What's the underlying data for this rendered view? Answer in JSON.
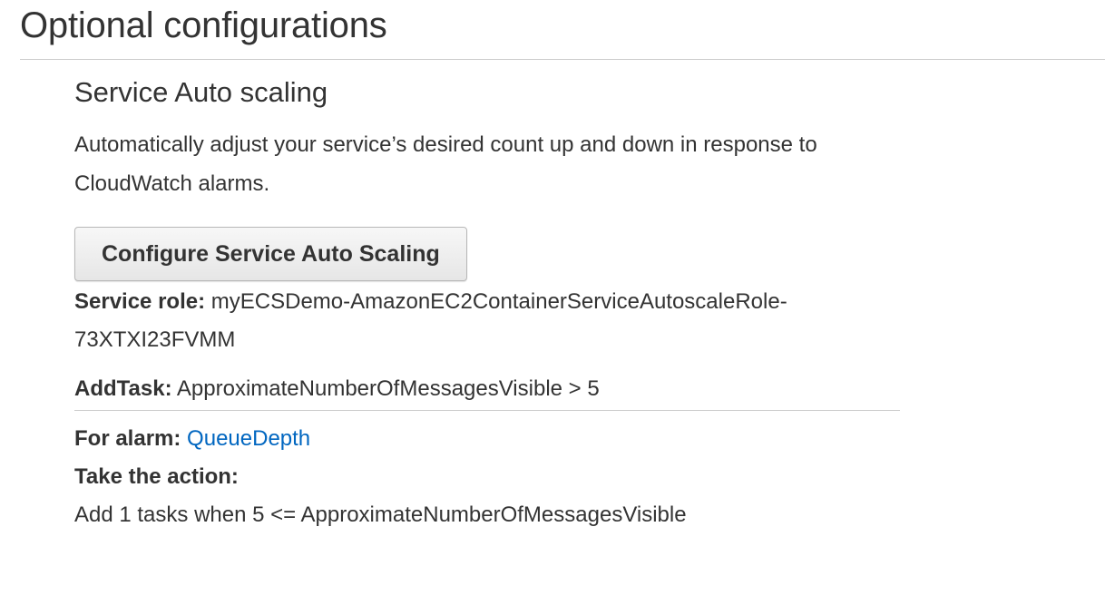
{
  "page": {
    "title": "Optional configurations"
  },
  "auto_scaling": {
    "title": "Service Auto scaling",
    "description": "Automatically adjust your service’s desired count up and down in response to CloudWatch alarms.",
    "configure_button_label": "Configure Service Auto Scaling",
    "service_role_label": "Service role:",
    "service_role_value": "myECSDemo-AmazonEC2ContainerServiceAutoscaleRole-73XTXI23FVMM",
    "policy": {
      "name_label": "AddTask:",
      "condition": "ApproximateNumberOfMessagesVisible > 5",
      "alarm_label": "For alarm:",
      "alarm_name": "QueueDepth",
      "action_label": "Take the action:",
      "action_value": "Add 1 tasks when 5 <= ApproximateNumberOfMessagesVisible"
    }
  },
  "colors": {
    "text": "#333333",
    "link": "#0066c0",
    "divider": "#cccccc"
  }
}
